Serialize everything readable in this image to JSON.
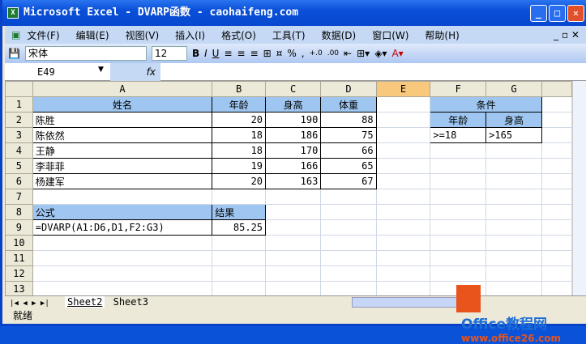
{
  "title": "Microsoft Excel - DVARP函数 - caohaifeng.com",
  "menu": [
    "文件(F)",
    "编辑(E)",
    "视图(V)",
    "插入(I)",
    "格式(O)",
    "工具(T)",
    "数据(D)",
    "窗口(W)",
    "帮助(H)"
  ],
  "toolbar": {
    "font": "宋体",
    "size": "12",
    "bold": "B",
    "italic": "I",
    "underline": "U",
    "percent": "%",
    "comma": ",",
    "inc_dec": "+.0",
    "dec_dec": ".00"
  },
  "formula_bar": {
    "name_box": "E49",
    "fx": "fx",
    "value": ""
  },
  "columns": [
    "A",
    "B",
    "C",
    "D",
    "E",
    "F",
    "G"
  ],
  "rows": [
    [
      "姓名",
      "年龄",
      "身高",
      "体重",
      "",
      "条件",
      ""
    ],
    [
      "陈胜",
      "20",
      "190",
      "88",
      "",
      "年龄",
      "身高"
    ],
    [
      "陈依然",
      "18",
      "186",
      "75",
      "",
      ">=18",
      ">165"
    ],
    [
      "王静",
      "18",
      "170",
      "66",
      "",
      "",
      ""
    ],
    [
      "李菲菲",
      "19",
      "166",
      "65",
      "",
      "",
      ""
    ],
    [
      "杨建军",
      "20",
      "163",
      "67",
      "",
      "",
      ""
    ],
    [
      "",
      "",
      "",
      "",
      "",
      "",
      ""
    ],
    [
      "公式",
      "结果",
      "",
      "",
      "",
      "",
      ""
    ],
    [
      "=DVARP(A1:D6,D1,F2:G3)",
      "85.25",
      "",
      "",
      "",
      "",
      ""
    ],
    [
      "",
      "",
      "",
      "",
      "",
      "",
      ""
    ],
    [
      "",
      "",
      "",
      "",
      "",
      "",
      ""
    ],
    [
      "",
      "",
      "",
      "",
      "",
      "",
      ""
    ],
    [
      "",
      "",
      "",
      "",
      "",
      "",
      ""
    ]
  ],
  "sheet_tabs": [
    "Sheet2",
    "Sheet3"
  ],
  "status": "就绪",
  "watermark": {
    "name": "Office教程网",
    "url": "www.office26.com"
  }
}
